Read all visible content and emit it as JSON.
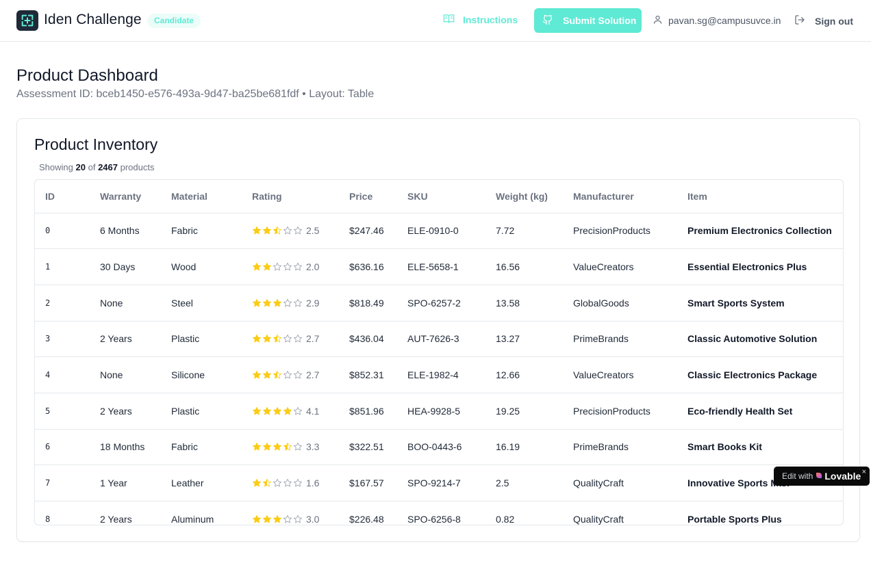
{
  "header": {
    "app_title": "Iden Challenge",
    "badge": "Candidate",
    "instructions_label": "Instructions",
    "submit_label": "Submit Solution",
    "user_email": "pavan.sg@campusuvce.in",
    "signout_label": "Sign out"
  },
  "page": {
    "title": "Product Dashboard",
    "subtitle": "Assessment ID: bceb1450-e576-493a-9d47-ba25be681fdf • Layout: Table"
  },
  "card": {
    "title": "Product Inventory",
    "showing_prefix": "Showing",
    "showing_count": "20",
    "showing_of": "of",
    "showing_total": "2467",
    "showing_suffix": "products"
  },
  "table": {
    "columns": [
      "ID",
      "Warranty",
      "Material",
      "Rating",
      "Price",
      "SKU",
      "Weight (kg)",
      "Manufacturer",
      "Item"
    ],
    "rows": [
      {
        "id": "0",
        "warranty": "6 Months",
        "material": "Fabric",
        "rating": 2.5,
        "rating_text": "2.5",
        "price": "$247.46",
        "sku": "ELE-0910-0",
        "weight": "7.72",
        "manufacturer": "PrecisionProducts",
        "item": "Premium Electronics Collection"
      },
      {
        "id": "1",
        "warranty": "30 Days",
        "material": "Wood",
        "rating": 2.0,
        "rating_text": "2.0",
        "price": "$636.16",
        "sku": "ELE-5658-1",
        "weight": "16.56",
        "manufacturer": "ValueCreators",
        "item": "Essential Electronics Plus"
      },
      {
        "id": "2",
        "warranty": "None",
        "material": "Steel",
        "rating": 2.9,
        "rating_text": "2.9",
        "price": "$818.49",
        "sku": "SPO-6257-2",
        "weight": "13.58",
        "manufacturer": "GlobalGoods",
        "item": "Smart Sports System"
      },
      {
        "id": "3",
        "warranty": "2 Years",
        "material": "Plastic",
        "rating": 2.7,
        "rating_text": "2.7",
        "price": "$436.04",
        "sku": "AUT-7626-3",
        "weight": "13.27",
        "manufacturer": "PrimeBrands",
        "item": "Classic Automotive Solution"
      },
      {
        "id": "4",
        "warranty": "None",
        "material": "Silicone",
        "rating": 2.7,
        "rating_text": "2.7",
        "price": "$852.31",
        "sku": "ELE-1982-4",
        "weight": "12.66",
        "manufacturer": "ValueCreators",
        "item": "Classic Electronics Package"
      },
      {
        "id": "5",
        "warranty": "2 Years",
        "material": "Plastic",
        "rating": 4.1,
        "rating_text": "4.1",
        "price": "$851.96",
        "sku": "HEA-9928-5",
        "weight": "19.25",
        "manufacturer": "PrecisionProducts",
        "item": "Eco-friendly Health Set"
      },
      {
        "id": "6",
        "warranty": "18 Months",
        "material": "Fabric",
        "rating": 3.3,
        "rating_text": "3.3",
        "price": "$322.51",
        "sku": "BOO-0443-6",
        "weight": "16.19",
        "manufacturer": "PrimeBrands",
        "item": "Smart Books Kit"
      },
      {
        "id": "7",
        "warranty": "1 Year",
        "material": "Leather",
        "rating": 1.6,
        "rating_text": "1.6",
        "price": "$167.57",
        "sku": "SPO-9214-7",
        "weight": "2.5",
        "manufacturer": "QualityCraft",
        "item": "Innovative Sports Max"
      },
      {
        "id": "8",
        "warranty": "2 Years",
        "material": "Aluminum",
        "rating": 3.0,
        "rating_text": "3.0",
        "price": "$226.48",
        "sku": "SPO-6256-8",
        "weight": "0.82",
        "manufacturer": "QualityCraft",
        "item": "Portable Sports Plus"
      }
    ]
  },
  "lovable": {
    "edit_with": "Edit with",
    "brand": "Lovable",
    "close": "×"
  },
  "colors": {
    "accent": "#5eead4",
    "star_filled": "#facc15",
    "star_empty": "#9ca3af"
  },
  "icons": {
    "logo": "app-logo-icon",
    "instructions": "book-open-icon",
    "submit": "github-icon",
    "user": "user-icon",
    "signout": "log-out-icon",
    "star": "star-icon"
  }
}
